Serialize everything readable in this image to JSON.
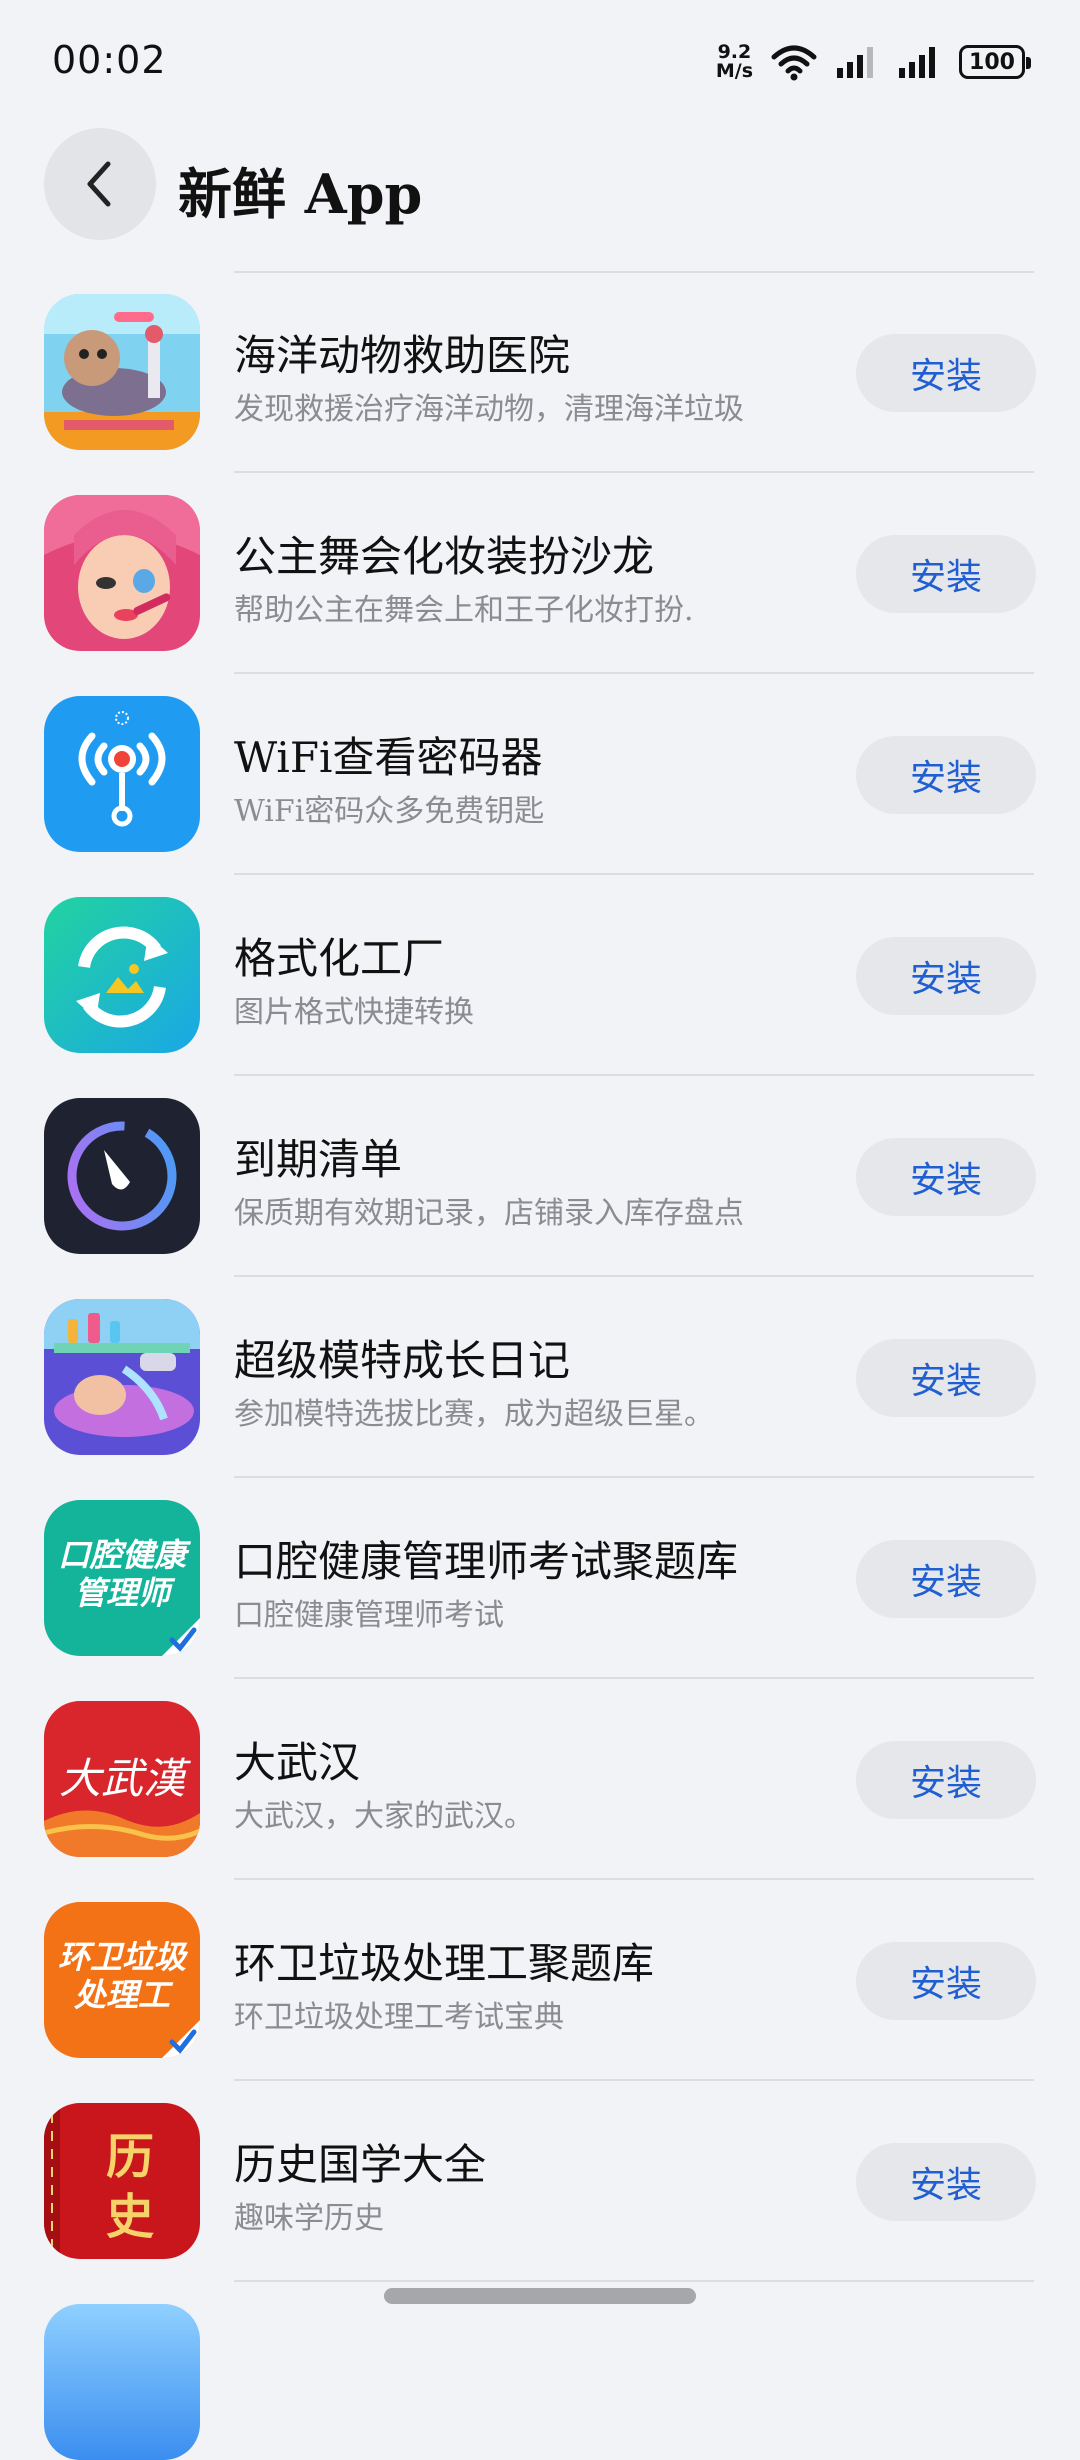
{
  "status_bar": {
    "time": "00:02",
    "net_speed_value": "9.2",
    "net_speed_unit": "M/s",
    "battery": "100"
  },
  "header": {
    "title": "新鲜 App"
  },
  "apps": [
    {
      "name": "海洋动物救助医院",
      "desc": "发现救援治疗海洋动物，清理海洋垃圾",
      "action": "安装"
    },
    {
      "name": "公主舞会化妆装扮沙龙",
      "desc": "帮助公主在舞会上和王子化妆打扮.",
      "action": "安装"
    },
    {
      "name": "WiFi查看密码器",
      "desc": "WiFi密码众多免费钥匙",
      "action": "安装"
    },
    {
      "name": "格式化工厂",
      "desc": "图片格式快捷转换",
      "action": "安装"
    },
    {
      "name": "到期清单",
      "desc": "保质期有效期记录，店铺录入库存盘点",
      "action": "安装"
    },
    {
      "name": "超级模特成长日记",
      "desc": "参加模特选拔比赛，成为超级巨星。",
      "action": "安装"
    },
    {
      "name": "口腔健康管理师考试聚题库",
      "desc": "口腔健康管理师考试",
      "action": "安装",
      "icon_text": [
        "口腔健康",
        "管理师"
      ]
    },
    {
      "name": "大武汉",
      "desc": "大武汉，大家的武汉。",
      "action": "安装",
      "icon_text": [
        "大武漢"
      ]
    },
    {
      "name": "环卫垃圾处理工聚题库",
      "desc": "环卫垃圾处理工考试宝典",
      "action": "安装",
      "icon_text": [
        "环卫垃圾",
        "处理工"
      ]
    },
    {
      "name": "历史国学大全",
      "desc": "趣味学历史",
      "action": "安装",
      "icon_text": [
        "历",
        "史"
      ]
    }
  ],
  "colors": {
    "background": "#f2f3f6",
    "install_text": "#1f5fd1",
    "install_bg": "#e6e7eb",
    "desc_text": "#8a8c92"
  }
}
